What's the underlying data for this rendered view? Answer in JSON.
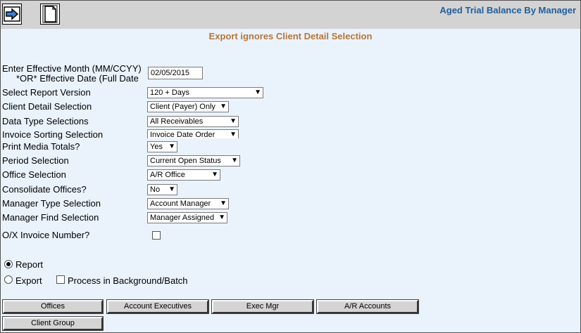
{
  "header": {
    "title": "Aged Trial Balance By Manager",
    "subtitle": "Export ignores Client Detail Selection",
    "toolbar_icons": [
      "arrow-right-icon",
      "document-icon"
    ]
  },
  "form": {
    "effective_label_line1": "Enter Effective Month (MM/CCYY)",
    "effective_label_line2": "*OR* Effective Date (Full Date",
    "effective_value": "02/05/2015",
    "report_version": {
      "label": "Select Report Version",
      "value": "120 + Days"
    },
    "client_detail": {
      "label": "Client Detail Selection",
      "value": "Client (Payer) Only"
    },
    "data_type": {
      "label": "Data Type Selections",
      "value": "All Receivables"
    },
    "invoice_sort": {
      "label": "Invoice Sorting Selection",
      "value": "Invoice Date Order"
    },
    "print_media": {
      "label": "Print Media Totals?",
      "value": "Yes"
    },
    "period": {
      "label": "Period Selection",
      "value": "Current Open Status"
    },
    "office": {
      "label": "Office Selection",
      "value": "A/R Office"
    },
    "consolidate": {
      "label": "Consolidate Offices?",
      "value": "No"
    },
    "manager_type": {
      "label": "Manager Type Selection",
      "value": "Account Manager"
    },
    "manager_find": {
      "label": "Manager Find Selection",
      "value": "Manager Assigned"
    },
    "ox_invoice": {
      "label": "O/X Invoice Number?",
      "checked": false
    }
  },
  "output": {
    "report_label": "Report",
    "export_label": "Export",
    "background_label": "Process in Background/Batch",
    "selected": "Report"
  },
  "buttons": {
    "offices": "Offices",
    "account_executives": "Account Executives",
    "exec_mgr": "Exec Mgr",
    "ar_accounts": "A/R Accounts",
    "client_group": "Client Group"
  }
}
